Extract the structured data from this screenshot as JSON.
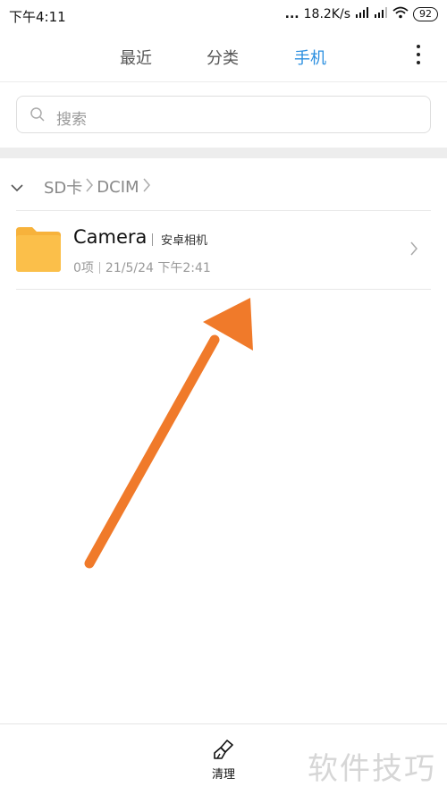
{
  "status_bar": {
    "time": "下午4:11",
    "dots": "...",
    "speed": "18.2K/s",
    "battery": "92"
  },
  "tabs": [
    {
      "label": "最近",
      "active": false
    },
    {
      "label": "分类",
      "active": false
    },
    {
      "label": "手机",
      "active": true
    }
  ],
  "search": {
    "placeholder": "搜索"
  },
  "breadcrumb": {
    "items": [
      "SD卡",
      "DCIM"
    ]
  },
  "folder": {
    "name": "Camera",
    "tag": "安卓相机",
    "count": "0项",
    "date": "21/5/24 下午2:41"
  },
  "bottom": {
    "clean_label": "清理"
  },
  "watermark": "软件技巧",
  "colors": {
    "accent": "#2b8fe0",
    "folder": "#f7b23b",
    "arrow": "#f07a2a"
  }
}
